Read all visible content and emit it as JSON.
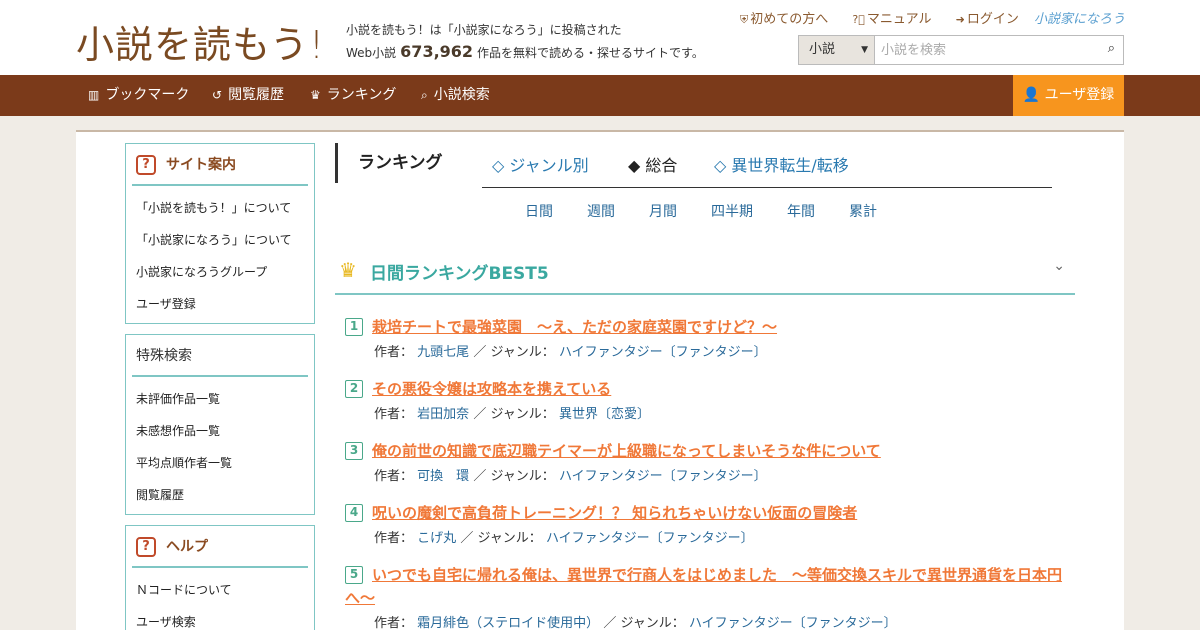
{
  "header": {
    "logo": "小説を読もう!",
    "tagline_line1": "小説を読もう！は「小説家になろう」に投稿された",
    "tagline_pre": "Web小説",
    "count": "673,962",
    "tagline_post": "作品を無料で読める・探せるサイトです。",
    "links": [
      "初めての方へ",
      "マニュアル",
      "ログイン"
    ],
    "brand": "小説家になろう",
    "search_select": "小説",
    "search_placeholder": "小説を検索"
  },
  "nav": {
    "items": [
      "ブックマーク",
      "閲覧履歴",
      "ランキング",
      "小説検索"
    ],
    "register": "ユーザ登録"
  },
  "sidebar": {
    "site_guide": {
      "title": "サイト案内",
      "items": [
        "「小説を読もう！」について",
        "「小説家になろう」について",
        "小説家になろうグループ",
        "ユーザ登録"
      ]
    },
    "special_search": {
      "title": "特殊検索",
      "items": [
        "未評価作品一覧",
        "未感想作品一覧",
        "平均点順作者一覧",
        "閲覧履歴"
      ]
    },
    "help": {
      "title": "ヘルプ",
      "items": [
        "Ｎコードについて",
        "ユーザ検索"
      ]
    }
  },
  "ranking": {
    "title": "ランキング",
    "tabs": [
      "◇ ジャンル別",
      "◆ 総合",
      "◇ 異世界転生/転移"
    ],
    "periods": [
      "日間",
      "週間",
      "月間",
      "四半期",
      "年間",
      "累計"
    ],
    "best_title": "日間ランキングBEST5",
    "author_label": "作者：",
    "genre_label": "／ ジャンル：",
    "entries": [
      {
        "rank": "1",
        "title": "栽培チートで最強菜園　～え、ただの家庭菜園ですけど？～",
        "author": "九頭七尾",
        "genre": "ハイファンタジー〔ファンタジー〕"
      },
      {
        "rank": "2",
        "title": "その悪役令嬢は攻略本を携えている",
        "author": "岩田加奈",
        "genre": "異世界〔恋愛〕"
      },
      {
        "rank": "3",
        "title": "俺の前世の知識で底辺職テイマーが上級職になってしまいそうな件について",
        "author": "可換　環",
        "genre": "ハイファンタジー〔ファンタジー〕"
      },
      {
        "rank": "4",
        "title": "呪いの魔剣で高負荷トレーニング！？ 知られちゃいけない仮面の冒険者",
        "author": "こげ丸",
        "genre": "ハイファンタジー〔ファンタジー〕"
      },
      {
        "rank": "5",
        "title": "いつでも自宅に帰れる俺は、異世界で行商人をはじめました　～等価交換スキルで異世界通貨を日本円へ～",
        "author": "霜月緋色（ステロイド使用中）",
        "genre": "ハイファンタジー〔ファンタジー〕"
      }
    ]
  }
}
